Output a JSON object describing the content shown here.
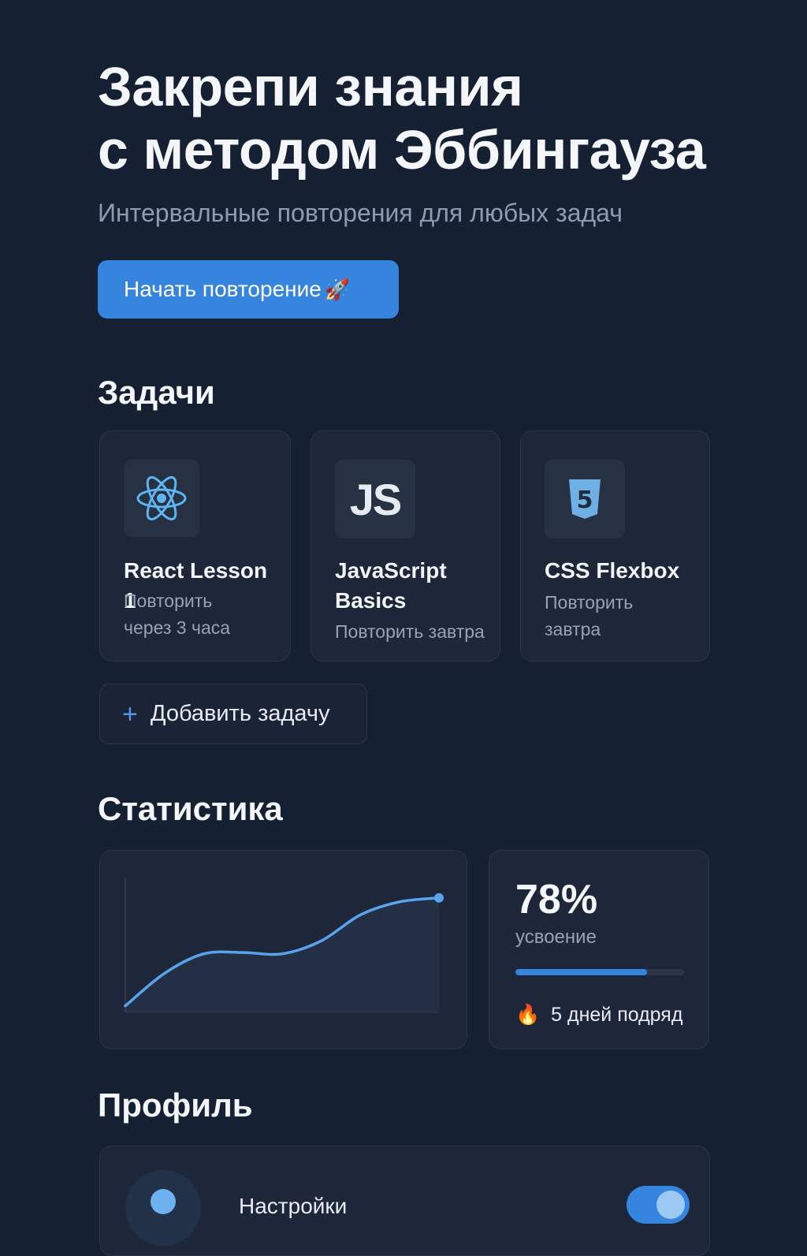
{
  "hero": {
    "title_line1": "Закрепи знания",
    "title_line2": "с методом Эббингауза",
    "subtitle": "Интервальные повторения для любых задач",
    "cta_label": "Начать повторение",
    "cta_icon": "rocket-icon"
  },
  "tasks": {
    "title": "Задачи",
    "items": [
      {
        "name": "React Lesson 1",
        "when_line1": "Повторить",
        "when_line2": "через 3 часа",
        "icon": "react-icon"
      },
      {
        "name_line1": "JavaScript",
        "name_line2": "Basics",
        "when": "Повторить завтра",
        "icon": "js-icon",
        "icon_text": "JS"
      },
      {
        "name": "CSS Flexbox",
        "when_line1": "Повторить",
        "when_line2": "завтра",
        "icon": "html5-icon",
        "icon_text": "5"
      }
    ],
    "add_label": "Добавить задачу",
    "add_icon": "plus-icon"
  },
  "stats": {
    "title": "Статистика",
    "percent": "78%",
    "percent_value": 78,
    "percent_label": "усвоение",
    "streak_icon": "fire-icon",
    "streak_label": "5 дней подряд"
  },
  "chart_data": {
    "type": "line",
    "title": "",
    "xlabel": "",
    "ylabel": "",
    "x": [
      0,
      1,
      2,
      3,
      4,
      5,
      6,
      7,
      8
    ],
    "values": [
      5,
      30,
      45,
      46,
      45,
      55,
      75,
      85,
      88
    ],
    "ylim": [
      0,
      100
    ],
    "grid": false,
    "color": "#5aa2ec"
  },
  "profile": {
    "title": "Профиль",
    "settings_label": "Настройки",
    "toggle_on": true
  },
  "colors": {
    "background": "#162033",
    "card": "#1d2739",
    "accent": "#3584dd",
    "line": "#5aa2ec"
  }
}
